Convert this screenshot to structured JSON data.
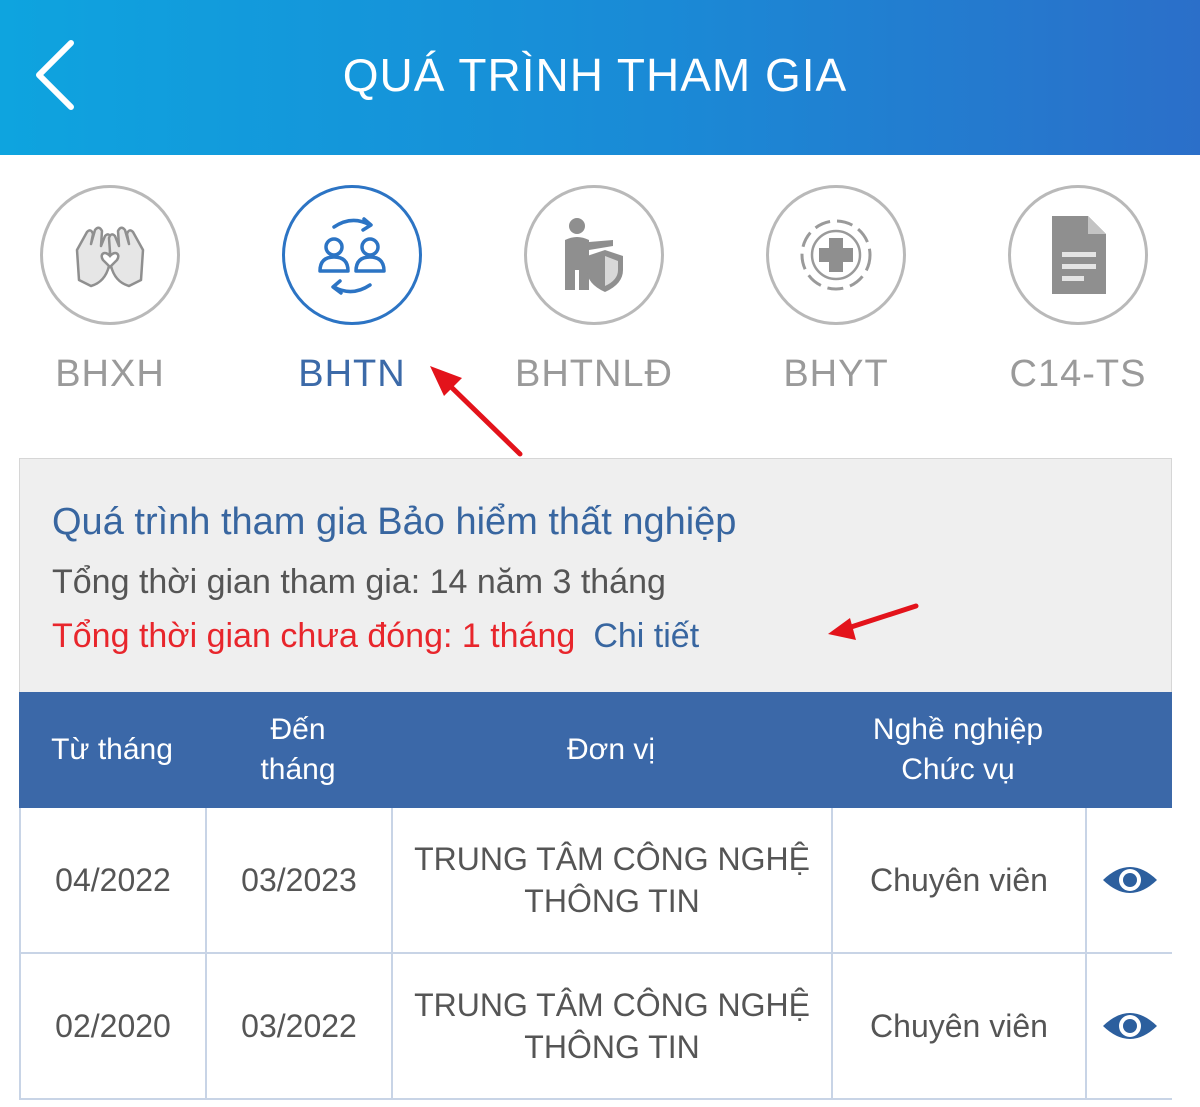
{
  "header": {
    "title": "QUÁ TRÌNH THAM GIA",
    "background_color": "#1a8ad6",
    "back_icon": "chevron-left-icon"
  },
  "tabs": [
    {
      "label": "BHXH",
      "icon": "hands-heart-icon",
      "active": false
    },
    {
      "label": "BHTN",
      "icon": "people-exchange-icon",
      "active": true
    },
    {
      "label": "BHTNLĐ",
      "icon": "worker-shield-icon",
      "active": false
    },
    {
      "label": "BHYT",
      "icon": "medical-cross-icon",
      "active": false
    },
    {
      "label": "C14-TS",
      "icon": "document-icon",
      "active": false
    }
  ],
  "summary": {
    "title": "Quá trình tham gia Bảo hiểm thất nghiệp",
    "total_time": "Tổng thời gian tham gia: 14 năm 3 tháng",
    "unpaid_time": "Tổng thời gian chưa đóng: 1 tháng",
    "detail_link": "Chi tiết"
  },
  "table": {
    "headers": {
      "from": "Từ tháng",
      "to_line1": "Đến",
      "to_line2": "tháng",
      "unit": "Đơn vị",
      "job_line1": "Nghề nghiệp",
      "job_line2": "Chức vụ"
    },
    "rows": [
      {
        "from": "04/2022",
        "to": "03/2023",
        "unit_line1": "TRUNG TÂM CÔNG NGHỆ",
        "unit_line2": "THÔNG TIN",
        "job": "Chuyên viên",
        "action_icon": "eye-icon"
      },
      {
        "from": "02/2020",
        "to": "03/2022",
        "unit_line1": "TRUNG TÂM CÔNG NGHỆ",
        "unit_line2": "THÔNG TIN",
        "job": "Chuyên viên",
        "action_icon": "eye-icon"
      }
    ]
  },
  "colors": {
    "accent": "#3b68a8",
    "unpaid": "#e8262c",
    "annotation_arrow": "#e3131b"
  }
}
